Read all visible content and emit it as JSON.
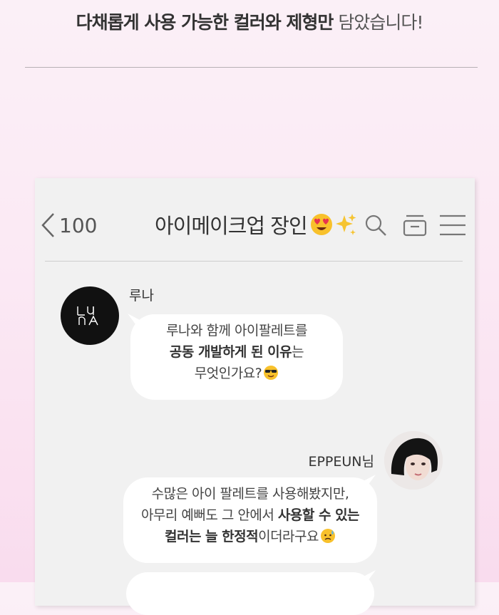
{
  "headline": {
    "bold_part": "다채롭게 사용 가능한 컬러와 제형만",
    "light_part": "담았습니다!"
  },
  "chat": {
    "header": {
      "back_count": "100",
      "title": "아이메이크업 장인",
      "icons": [
        "search-icon",
        "drawer-icon",
        "menu-icon"
      ]
    },
    "messages": [
      {
        "sender": "루나",
        "avatar_text": "LUNA",
        "lines": [
          [
            {
              "text": "루나와 함께 아이팔레트를",
              "bold": false
            }
          ],
          [
            {
              "text": "공동 개발하게 된 이유",
              "bold": true
            },
            {
              "text": "는",
              "bold": false
            }
          ],
          [
            {
              "text": "무엇인가요?",
              "bold": false
            }
          ]
        ]
      },
      {
        "sender": "EPPEUN님",
        "lines": [
          [
            {
              "text": "수많은 아이 팔레트를 사용해봤지만,",
              "bold": false
            }
          ],
          [
            {
              "text": "아무리 예뻐도 그 안에서 ",
              "bold": false
            },
            {
              "text": "사용할 수 있는",
              "bold": true
            }
          ],
          [
            {
              "text": "컬러는 늘 한정적",
              "bold": true
            },
            {
              "text": "이더라구요",
              "bold": false
            }
          ]
        ]
      }
    ]
  },
  "colors": {
    "background_top": "#fbf0f7",
    "background_bottom": "#f9dcee",
    "chat_background": "#f1f1f1",
    "bubble": "#ffffff"
  }
}
